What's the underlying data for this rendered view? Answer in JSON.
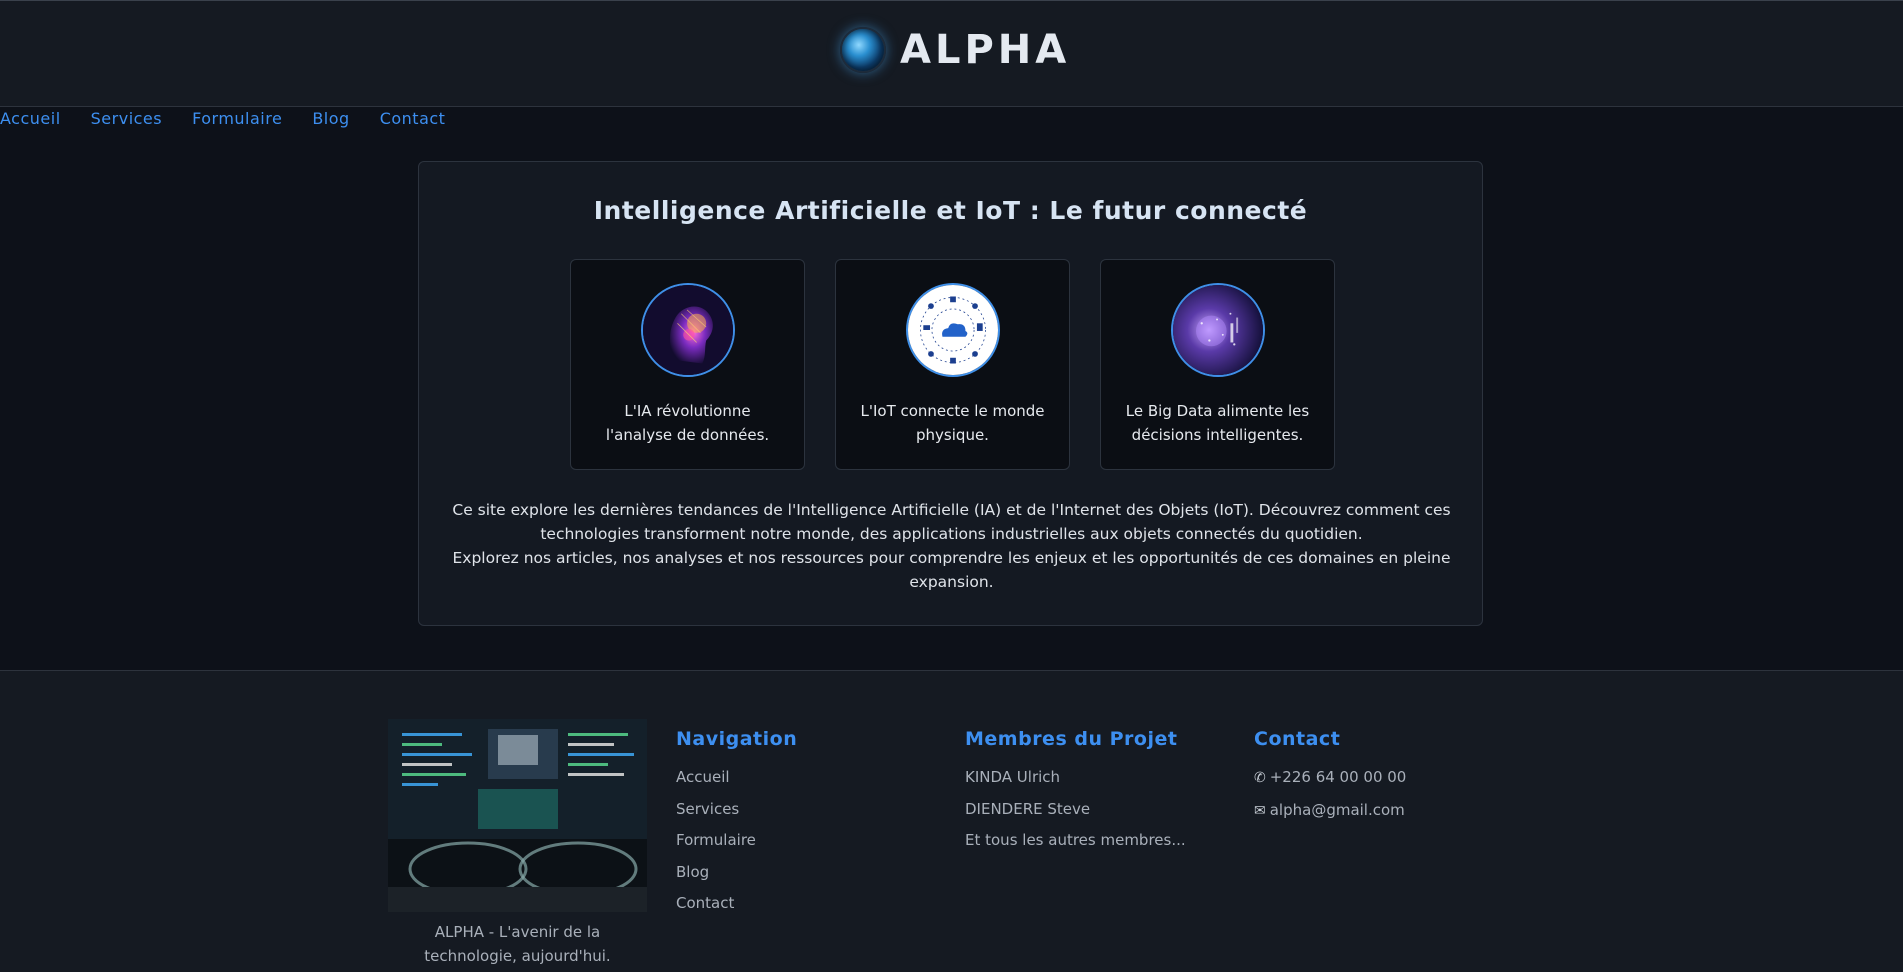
{
  "header": {
    "brand": "ALPHA",
    "logo_icon": "globe-icon"
  },
  "nav": {
    "items": [
      "Accueil",
      "Services",
      "Formulaire",
      "Blog",
      "Contact"
    ]
  },
  "main": {
    "title": "Intelligence Artificielle et IoT : Le futur connecté",
    "features": [
      {
        "icon": "ai-head-icon",
        "text": "L'IA révolutionne l'analyse de données."
      },
      {
        "icon": "iot-cloud-icon",
        "text": "L'IoT connecte le monde physique."
      },
      {
        "icon": "big-data-icon",
        "text": "Le Big Data alimente les décisions intelligentes."
      }
    ],
    "intro_line1": "Ce site explore les dernières tendances de l'Intelligence Artificielle (IA) et de l'Internet des Objets (IoT). Découvrez comment ces technologies transforment notre monde, des applications industrielles aux objets connectés du quotidien.",
    "intro_line2": "Explorez nos articles, nos analyses et nos ressources pour comprendre les enjeux et les opportunités de ces domaines en pleine expansion."
  },
  "footer": {
    "caption": "ALPHA - L'avenir de la technologie, aujourd'hui.",
    "navigation": {
      "title": "Navigation",
      "items": [
        "Accueil",
        "Services",
        "Formulaire",
        "Blog",
        "Contact"
      ]
    },
    "members": {
      "title": "Membres du Projet",
      "items": [
        "KINDA Ulrich",
        "DIENDERE Steve",
        "Et tous les autres membres..."
      ]
    },
    "contact": {
      "title": "Contact",
      "phone": "+226 64 00 00 00",
      "email": "alpha@gmail.com"
    }
  },
  "colors": {
    "accent": "#3d8ff0",
    "background": "#0d1119",
    "panel": "#151a22"
  }
}
